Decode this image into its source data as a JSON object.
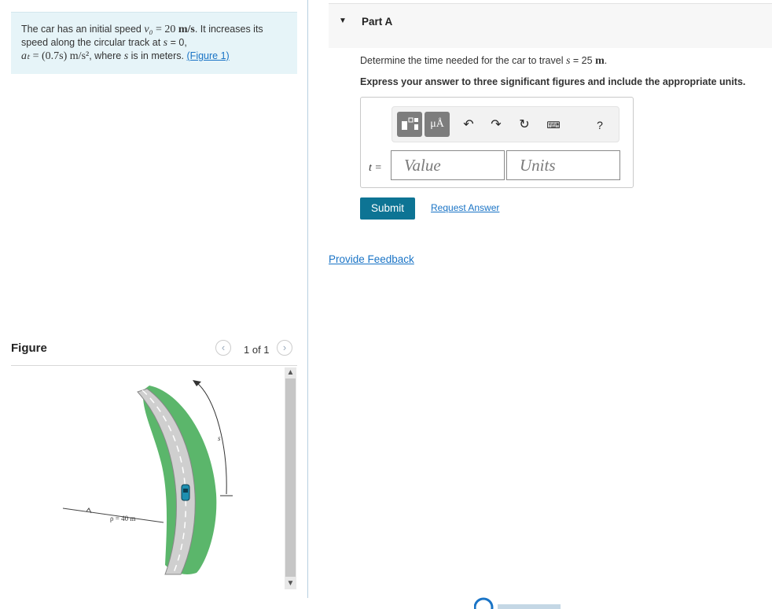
{
  "problem": {
    "intro": "The car has an initial speed",
    "v0_symbol": "v₀",
    "v0_value": "= 20",
    "v0_units": "m/s",
    "sentence2": ". It increases its speed along the circular track at",
    "s_symbol": "s",
    "s_value": "= 0,",
    "at_symbol": "aₜ",
    "at_expr": "= (0.7s) m/s²",
    "where_text": ", where",
    "where_s": "s",
    "where_tail": "is in meters.",
    "figure_link": "(Figure 1)"
  },
  "figure": {
    "title": "Figure",
    "count": "1 of 1",
    "prev_icon": "chevron-left-icon",
    "next_icon": "chevron-right-icon",
    "rho_label": "ρ = 40 m",
    "s_label": "s"
  },
  "part": {
    "title": "Part A",
    "toggle_icon": "caret-down-icon"
  },
  "question": {
    "text": "Determine the time needed for the car to travel",
    "s": "s",
    "equals": "= 25",
    "unit": "m",
    "period": "."
  },
  "instruction": "Express your answer to three significant figures and include the appropriate units.",
  "answer": {
    "variable_label": "t =",
    "value_placeholder": "Value",
    "units_placeholder": "Units",
    "toolbar": {
      "templates_icon": "templates-icon",
      "units_button": "μÅ",
      "undo_icon": "undo-icon",
      "redo_icon": "redo-icon",
      "reset_icon": "reset-icon",
      "keyboard_icon": "keyboard-icon",
      "help": "?"
    }
  },
  "submit_label": "Submit",
  "request_answer_label": "Request Answer",
  "feedback_label": "Provide Feedback",
  "colors": {
    "accent": "#0d7494",
    "link": "#1a74c6",
    "problem_bg": "#e6f4f8",
    "grass": "#5bb66b",
    "road": "#c9c9c9"
  }
}
